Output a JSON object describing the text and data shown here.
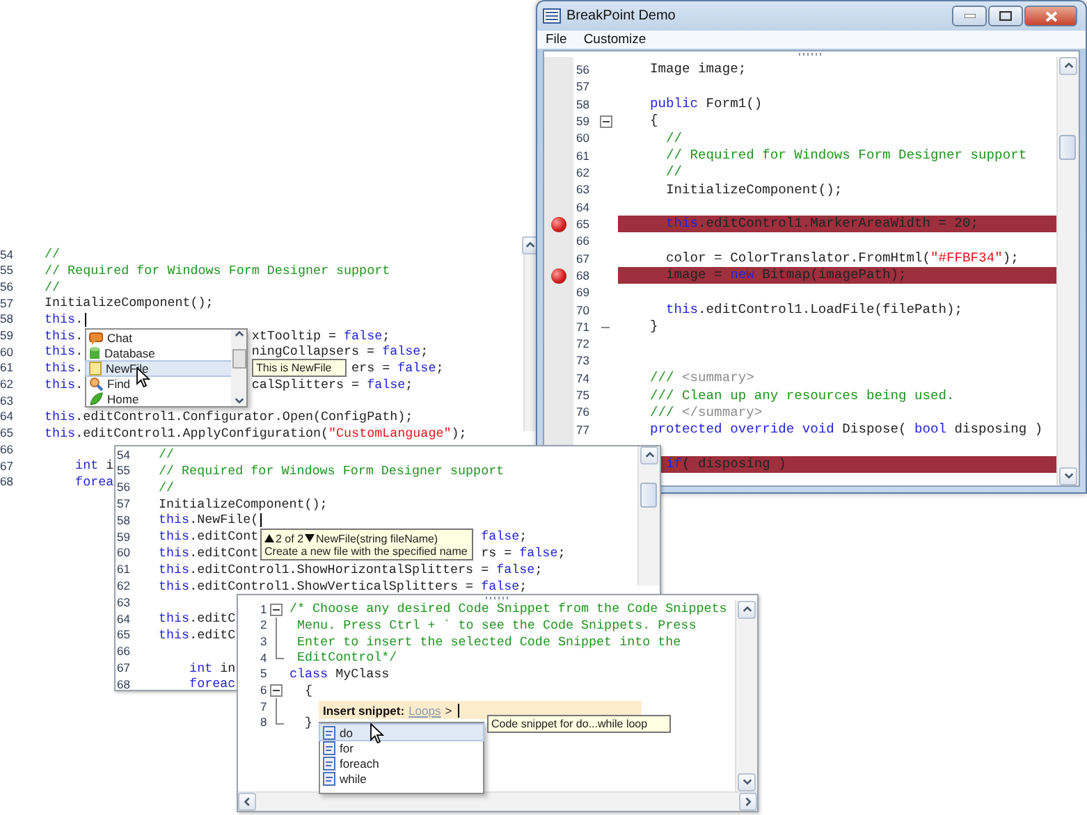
{
  "windows": [
    {
      "kind": "editor",
      "lines": [
        {
          "number": "54",
          "segments": [
            [
              {
                "kind": "comment",
                "text": "//"
              }
            ]
          ]
        },
        {
          "number": "55",
          "segments": [
            [
              {
                "kind": "comment",
                "text": "// Required for Windows Form Designer support"
              }
            ]
          ]
        },
        {
          "number": "56",
          "segments": [
            [
              {
                "kind": "comment",
                "text": "//"
              }
            ]
          ]
        },
        {
          "number": "57",
          "segments": [
            [
              {
                "kind": "plain",
                "text": "InitializeComponent();"
              }
            ]
          ]
        },
        {
          "number": "58",
          "segments": [
            [
              {
                "kind": "keyword",
                "text": "this"
              },
              {
                "kind": "plain",
                "text": "."
              }
            ]
          ],
          "caret": true
        },
        {
          "number": "59",
          "segments": [
            [
              {
                "kind": "keyword",
                "text": "this"
              },
              {
                "kind": "plain",
                "text": "."
              }
            ],
            [
              {
                "kind": "plain",
                "text": "xtTooltip = "
              },
              {
                "kind": "keyword",
                "text": "false"
              },
              {
                "kind": "plain",
                "text": ";"
              }
            ]
          ]
        },
        {
          "number": "60",
          "segments": [
            [
              {
                "kind": "keyword",
                "text": "this"
              },
              {
                "kind": "plain",
                "text": "."
              }
            ],
            [
              {
                "kind": "plain",
                "text": "ningCollapsers = "
              },
              {
                "kind": "keyword",
                "text": "false"
              },
              {
                "kind": "plain",
                "text": ";"
              }
            ]
          ]
        },
        {
          "number": "61",
          "segments": [
            [
              {
                "kind": "keyword",
                "text": "this"
              },
              {
                "kind": "plain",
                "text": "."
              }
            ],
            [
              {
                "kind": "plain",
                "text": "ers = "
              },
              {
                "kind": "keyword",
                "text": "false"
              },
              {
                "kind": "plain",
                "text": ";"
              }
            ]
          ]
        },
        {
          "number": "62",
          "segments": [
            [
              {
                "kind": "keyword",
                "text": "this"
              },
              {
                "kind": "plain",
                "text": "."
              }
            ],
            [
              {
                "kind": "plain",
                "text": "calSplitters = "
              },
              {
                "kind": "keyword",
                "text": "false"
              },
              {
                "kind": "plain",
                "text": ";"
              }
            ]
          ]
        },
        {
          "number": "63"
        },
        {
          "number": "64",
          "segments": [
            [
              {
                "kind": "keyword",
                "text": "this"
              },
              {
                "kind": "plain",
                "text": ".editControl1.Configurator.Open(ConfigPath);"
              }
            ]
          ]
        },
        {
          "number": "65",
          "segments": [
            [
              {
                "kind": "keyword",
                "text": "this"
              },
              {
                "kind": "plain",
                "text": ".editControl1.ApplyConfiguration("
              },
              {
                "kind": "string",
                "text": "\"CustomLanguage\""
              },
              {
                "kind": "plain",
                "text": ");"
              }
            ]
          ]
        },
        {
          "number": "66"
        },
        {
          "number": "67",
          "segments": [
            [
              {
                "kind": "keyword",
                "text": "    int"
              },
              {
                "kind": "plain",
                "text": " i"
              }
            ]
          ]
        },
        {
          "number": "68",
          "segments": [
            [
              {
                "kind": "keyword",
                "text": "    forea"
              }
            ]
          ]
        }
      ],
      "completion": {
        "items": [
          {
            "kind": "chat",
            "label": "Chat",
            "selected": false
          },
          {
            "kind": "database",
            "label": "Database",
            "selected": false
          },
          {
            "kind": "file",
            "label": "NewFile",
            "selected": true
          },
          {
            "kind": "find",
            "label": "Find",
            "selected": false
          },
          {
            "kind": "home",
            "label": "Home",
            "selected": false
          }
        ],
        "tooltip": "This is NewFile"
      }
    },
    {
      "kind": "app",
      "title": "BreakPoint Demo",
      "menu": [
        "File",
        "Customize"
      ],
      "lines": [
        {
          "number": "56",
          "segments": [
            [
              {
                "kind": "plain",
                "text": "Image image;"
              }
            ]
          ],
          "breakpoint": false,
          "highlighted": false
        },
        {
          "number": "57",
          "breakpoint": false,
          "highlighted": false
        },
        {
          "number": "58",
          "segments": [
            [
              {
                "kind": "keyword",
                "text": "public"
              },
              {
                "kind": "plain",
                "text": " Form1()"
              }
            ]
          ],
          "breakpoint": false,
          "highlighted": false
        },
        {
          "number": "59",
          "segments": [
            [
              {
                "kind": "plain",
                "text": "{"
              }
            ]
          ],
          "kind": "opener",
          "breakpoint": false,
          "highlighted": false
        },
        {
          "number": "60",
          "segments": [
            [
              {
                "kind": "comment",
                "text": "  //"
              }
            ]
          ],
          "breakpoint": false,
          "highlighted": false
        },
        {
          "number": "61",
          "segments": [
            [
              {
                "kind": "comment",
                "text": "  // Required for Windows Form Designer support"
              }
            ]
          ],
          "breakpoint": false,
          "highlighted": false
        },
        {
          "number": "62",
          "segments": [
            [
              {
                "kind": "comment",
                "text": "  //"
              }
            ]
          ],
          "breakpoint": false,
          "highlighted": false
        },
        {
          "number": "63",
          "segments": [
            [
              {
                "kind": "plain",
                "text": "  InitializeComponent();"
              }
            ]
          ],
          "breakpoint": false,
          "highlighted": false
        },
        {
          "number": "64",
          "breakpoint": false,
          "highlighted": false
        },
        {
          "number": "65",
          "segments": [
            [
              {
                "kind": "keyword",
                "text": "  this"
              },
              {
                "kind": "plain",
                "text": ".editControl1.MarkerAreaWidth = 20;"
              }
            ]
          ],
          "breakpoint": true,
          "highlighted": true
        },
        {
          "number": "66",
          "breakpoint": false,
          "highlighted": false
        },
        {
          "number": "67",
          "segments": [
            [
              {
                "kind": "plain",
                "text": "  color = ColorTranslator.FromHtml("
              },
              {
                "kind": "string",
                "text": "\"#FFBF34\""
              },
              {
                "kind": "plain",
                "text": ");"
              }
            ]
          ],
          "breakpoint": false,
          "highlighted": false
        },
        {
          "number": "68",
          "segments": [
            [
              {
                "kind": "plain",
                "text": "  image = "
              },
              {
                "kind": "keyword",
                "text": "new"
              },
              {
                "kind": "plain",
                "text": " Bitmap(imagePath);"
              }
            ]
          ],
          "breakpoint": true,
          "highlighted": true
        },
        {
          "number": "69",
          "breakpoint": false,
          "highlighted": false
        },
        {
          "number": "70",
          "segments": [
            [
              {
                "kind": "keyword",
                "text": "  this"
              },
              {
                "kind": "plain",
                "text": ".editControl1.LoadFile(filePath);"
              }
            ]
          ],
          "breakpoint": false,
          "highlighted": false
        },
        {
          "number": "71",
          "segments": [
            [
              {
                "kind": "plain",
                "text": "}"
              }
            ]
          ],
          "kind": "closer",
          "breakpoint": false,
          "highlighted": false
        },
        {
          "number": "72",
          "breakpoint": false,
          "highlighted": false
        },
        {
          "number": "73",
          "breakpoint": false,
          "highlighted": false
        },
        {
          "number": "74",
          "segments": [
            [
              {
                "kind": "comment",
                "text": "/// "
              },
              {
                "kind": "doc",
                "text": "<summary>"
              }
            ]
          ],
          "breakpoint": false,
          "highlighted": false
        },
        {
          "number": "75",
          "segments": [
            [
              {
                "kind": "comment",
                "text": "/// Clean up any resources being used."
              }
            ]
          ],
          "breakpoint": false,
          "highlighted": false
        },
        {
          "number": "76",
          "segments": [
            [
              {
                "kind": "comment",
                "text": "/// "
              },
              {
                "kind": "doc",
                "text": "</summary>"
              }
            ]
          ],
          "breakpoint": false,
          "highlighted": false
        },
        {
          "number": "77",
          "segments": [
            [
              {
                "kind": "keyword",
                "text": "protected override void"
              },
              {
                "kind": "plain",
                "text": " Dispose( "
              },
              {
                "kind": "keyword",
                "text": "bool"
              },
              {
                "kind": "plain",
                "text": " disposing )"
              }
            ]
          ],
          "breakpoint": false,
          "highlighted": false
        },
        {
          "breakpoint": false,
          "highlighted": false
        },
        {
          "segments": [
            [
              {
                "kind": "keyword",
                "text": "  if"
              },
              {
                "kind": "plain",
                "text": "( disposing )"
              }
            ]
          ],
          "breakpoint": false,
          "highlighted": true
        }
      ]
    },
    {
      "kind": "editor",
      "lines": [
        {
          "number": "54",
          "segments": [
            [
              {
                "kind": "comment",
                "text": "//"
              }
            ]
          ]
        },
        {
          "number": "55",
          "segments": [
            [
              {
                "kind": "comment",
                "text": "// Required for Windows Form Designer support"
              }
            ]
          ]
        },
        {
          "number": "56",
          "segments": [
            [
              {
                "kind": "comment",
                "text": "//"
              }
            ]
          ]
        },
        {
          "number": "57",
          "segments": [
            [
              {
                "kind": "plain",
                "text": "InitializeComponent();"
              }
            ]
          ]
        },
        {
          "number": "58",
          "segments": [
            [
              {
                "kind": "keyword",
                "text": "this"
              },
              {
                "kind": "plain",
                "text": ".NewFile("
              }
            ]
          ],
          "caret": true
        },
        {
          "number": "59",
          "segments": [
            [
              {
                "kind": "keyword",
                "text": "this"
              },
              {
                "kind": "plain",
                "text": ".editCont"
              }
            ],
            [
              {
                "kind": "keyword",
                "text": "false"
              },
              {
                "kind": "plain",
                "text": ";"
              }
            ]
          ]
        },
        {
          "number": "60",
          "segments": [
            [
              {
                "kind": "keyword",
                "text": "this"
              },
              {
                "kind": "plain",
                "text": ".editCont"
              }
            ],
            [
              {
                "kind": "plain",
                "text": "rs = "
              },
              {
                "kind": "keyword",
                "text": "false"
              },
              {
                "kind": "plain",
                "text": ";"
              }
            ]
          ]
        },
        {
          "number": "61",
          "segments": [
            [
              {
                "kind": "keyword",
                "text": "this"
              },
              {
                "kind": "plain",
                "text": ".editControl1.ShowHorizontalSplitters = "
              },
              {
                "kind": "keyword",
                "text": "false"
              },
              {
                "kind": "plain",
                "text": ";"
              }
            ]
          ]
        },
        {
          "number": "62",
          "segments": [
            [
              {
                "kind": "keyword",
                "text": "this"
              },
              {
                "kind": "plain",
                "text": ".editControl1.ShowVerticalSplitters = "
              },
              {
                "kind": "keyword",
                "text": "false"
              },
              {
                "kind": "plain",
                "text": ";"
              }
            ]
          ]
        },
        {
          "number": "63"
        },
        {
          "number": "64",
          "segments": [
            [
              {
                "kind": "keyword",
                "text": "this"
              },
              {
                "kind": "plain",
                "text": ".editC"
              }
            ]
          ]
        },
        {
          "number": "65",
          "segments": [
            [
              {
                "kind": "keyword",
                "text": "this"
              },
              {
                "kind": "plain",
                "text": ".editC"
              }
            ]
          ]
        },
        {
          "number": "66"
        },
        {
          "number": "67",
          "segments": [
            [
              {
                "kind": "keyword",
                "text": "    int"
              },
              {
                "kind": "plain",
                "text": " in"
              }
            ]
          ]
        },
        {
          "number": "68",
          "segments": [
            [
              {
                "kind": "keyword",
                "text": "    foreac"
              }
            ]
          ]
        }
      ],
      "param_info": {
        "counter": "2 of 2",
        "signature": "NewFile(string fileName)",
        "description": "Create a new file with the specified name"
      }
    },
    {
      "kind": "editor",
      "lines": [
        {
          "number": "1",
          "segments": [
            [
              {
                "kind": "comment",
                "text": "/* Choose any desired Code Snippet from the Code Snippets"
              }
            ]
          ],
          "kind": "opener"
        },
        {
          "number": "2",
          "segments": [
            [
              {
                "kind": "comment",
                "text": " Menu. Press Ctrl + ` to see the Code Snippets. Press"
              }
            ]
          ],
          "kind": "inner"
        },
        {
          "number": "3",
          "segments": [
            [
              {
                "kind": "comment",
                "text": " Enter to insert the selected Code Snippet into the"
              }
            ]
          ],
          "kind": "inner"
        },
        {
          "number": "4",
          "segments": [
            [
              {
                "kind": "comment",
                "text": " EditControl*/"
              }
            ]
          ],
          "kind": "closer"
        },
        {
          "number": "5",
          "segments": [
            [
              {
                "kind": "keyword",
                "text": "class"
              },
              {
                "kind": "plain",
                "text": " MyClass"
              }
            ]
          ]
        },
        {
          "number": "6",
          "segments": [
            [
              {
                "kind": "plain",
                "text": "  {"
              }
            ]
          ],
          "kind": "opener"
        },
        {
          "number": "7",
          "kind": "inner"
        },
        {
          "number": "8",
          "segments": [
            [
              {
                "kind": "plain",
                "text": "  }"
              }
            ]
          ],
          "kind": "closer"
        }
      ],
      "snippet": {
        "label": "Insert snippet:",
        "category": "Loops",
        "separator": ">",
        "items": [
          {
            "label": "do",
            "selected": true
          },
          {
            "label": "for",
            "selected": false
          },
          {
            "label": "foreach",
            "selected": false
          },
          {
            "label": "while",
            "selected": false
          }
        ],
        "tooltip": "Code snippet for do...while loop"
      }
    }
  ]
}
